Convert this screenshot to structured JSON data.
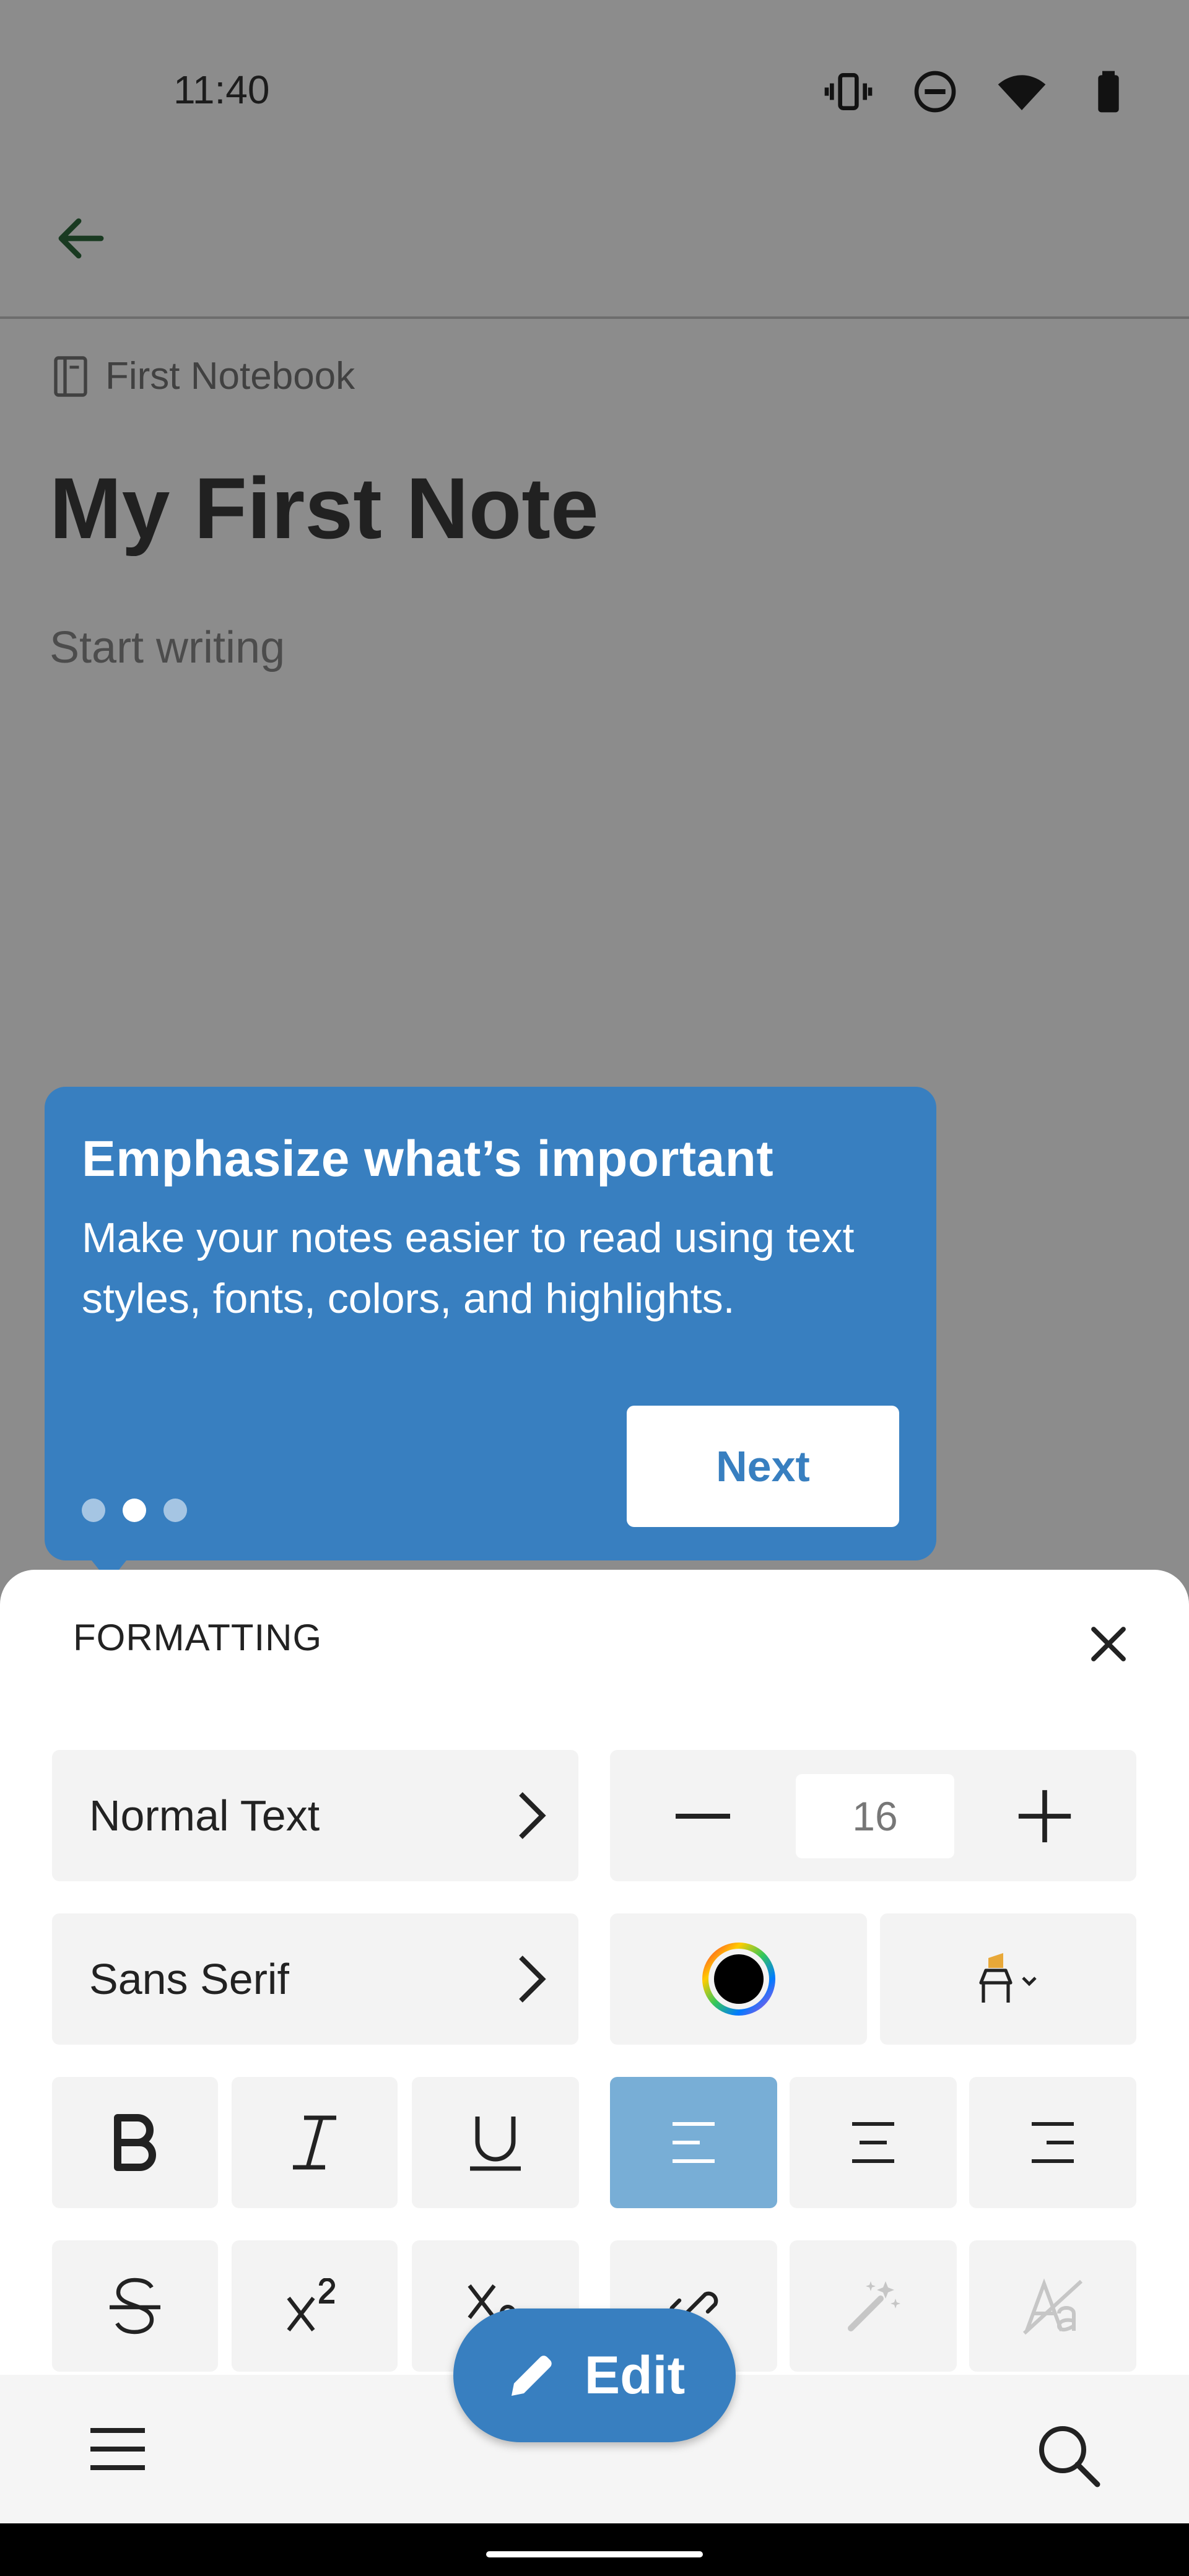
{
  "status_bar": {
    "time": "11:40",
    "icons": [
      "vibrate-icon",
      "do-not-disturb-icon",
      "wifi-icon",
      "battery-icon"
    ]
  },
  "app_bar": {
    "back_icon": "arrow-left-icon"
  },
  "note": {
    "notebook_icon": "notebook-icon",
    "notebook": "First Notebook",
    "title": "My First Note",
    "body_placeholder": "Start writing"
  },
  "tooltip": {
    "title": "Emphasize what’s important",
    "body": "Make your notes easier to read using text styles, fonts, colors, and highlights.",
    "next_label": "Next",
    "pages": 3,
    "current_page": 2,
    "background": "#387fc0"
  },
  "formatting": {
    "title": "FORMATTING",
    "close_icon": "close-icon",
    "text_style": "Normal Text",
    "font": "Sans Serif",
    "font_size": "16",
    "text_color": "#000000",
    "highlight_color": "#e8a838",
    "selected_alignment": "left",
    "buttons": [
      "bold-icon",
      "italic-icon",
      "underline-icon",
      "align-left-icon",
      "align-center-icon",
      "align-right-icon",
      "strikethrough-icon",
      "superscript-icon",
      "subscript-icon",
      "link-icon",
      "magic-wand-icon",
      "clear-format-icon"
    ]
  },
  "bottom_bar": {
    "menu_icon": "hamburger-menu-icon",
    "search_icon": "search-icon",
    "edit_label": "Edit",
    "accent": "#387fc0"
  }
}
